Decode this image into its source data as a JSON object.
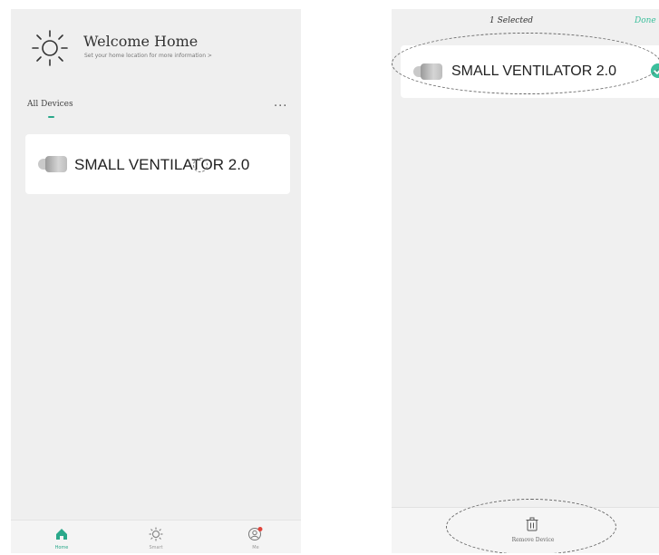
{
  "left_screen": {
    "header": {
      "title": "Welcome Home",
      "subtitle": "Set your home location for more information >"
    },
    "tabs": {
      "all_devices": "All Devices",
      "more": "..."
    },
    "device": {
      "name": "SMALL VENTILATOR 2.0",
      "icon": "ventilator-device-icon"
    },
    "bottom_nav": [
      {
        "label": "Home",
        "icon": "home-icon",
        "active": true
      },
      {
        "label": "Smart",
        "icon": "sun-icon",
        "active": false
      },
      {
        "label": "Me",
        "icon": "user-icon",
        "active": false
      }
    ]
  },
  "right_screen": {
    "top_bar": {
      "selected": "1 Selected",
      "done": "Done"
    },
    "device": {
      "name": "SMALL VENTILATOR 2.0",
      "icon": "ventilator-device-icon",
      "checked": true
    },
    "bottom_action": {
      "label": "Remove Device",
      "icon": "trash-icon"
    }
  },
  "colors": {
    "accent": "#2aa88a",
    "check": "#3cbf9c",
    "screen_bg": "#efefef",
    "card_bg": "#ffffff"
  }
}
